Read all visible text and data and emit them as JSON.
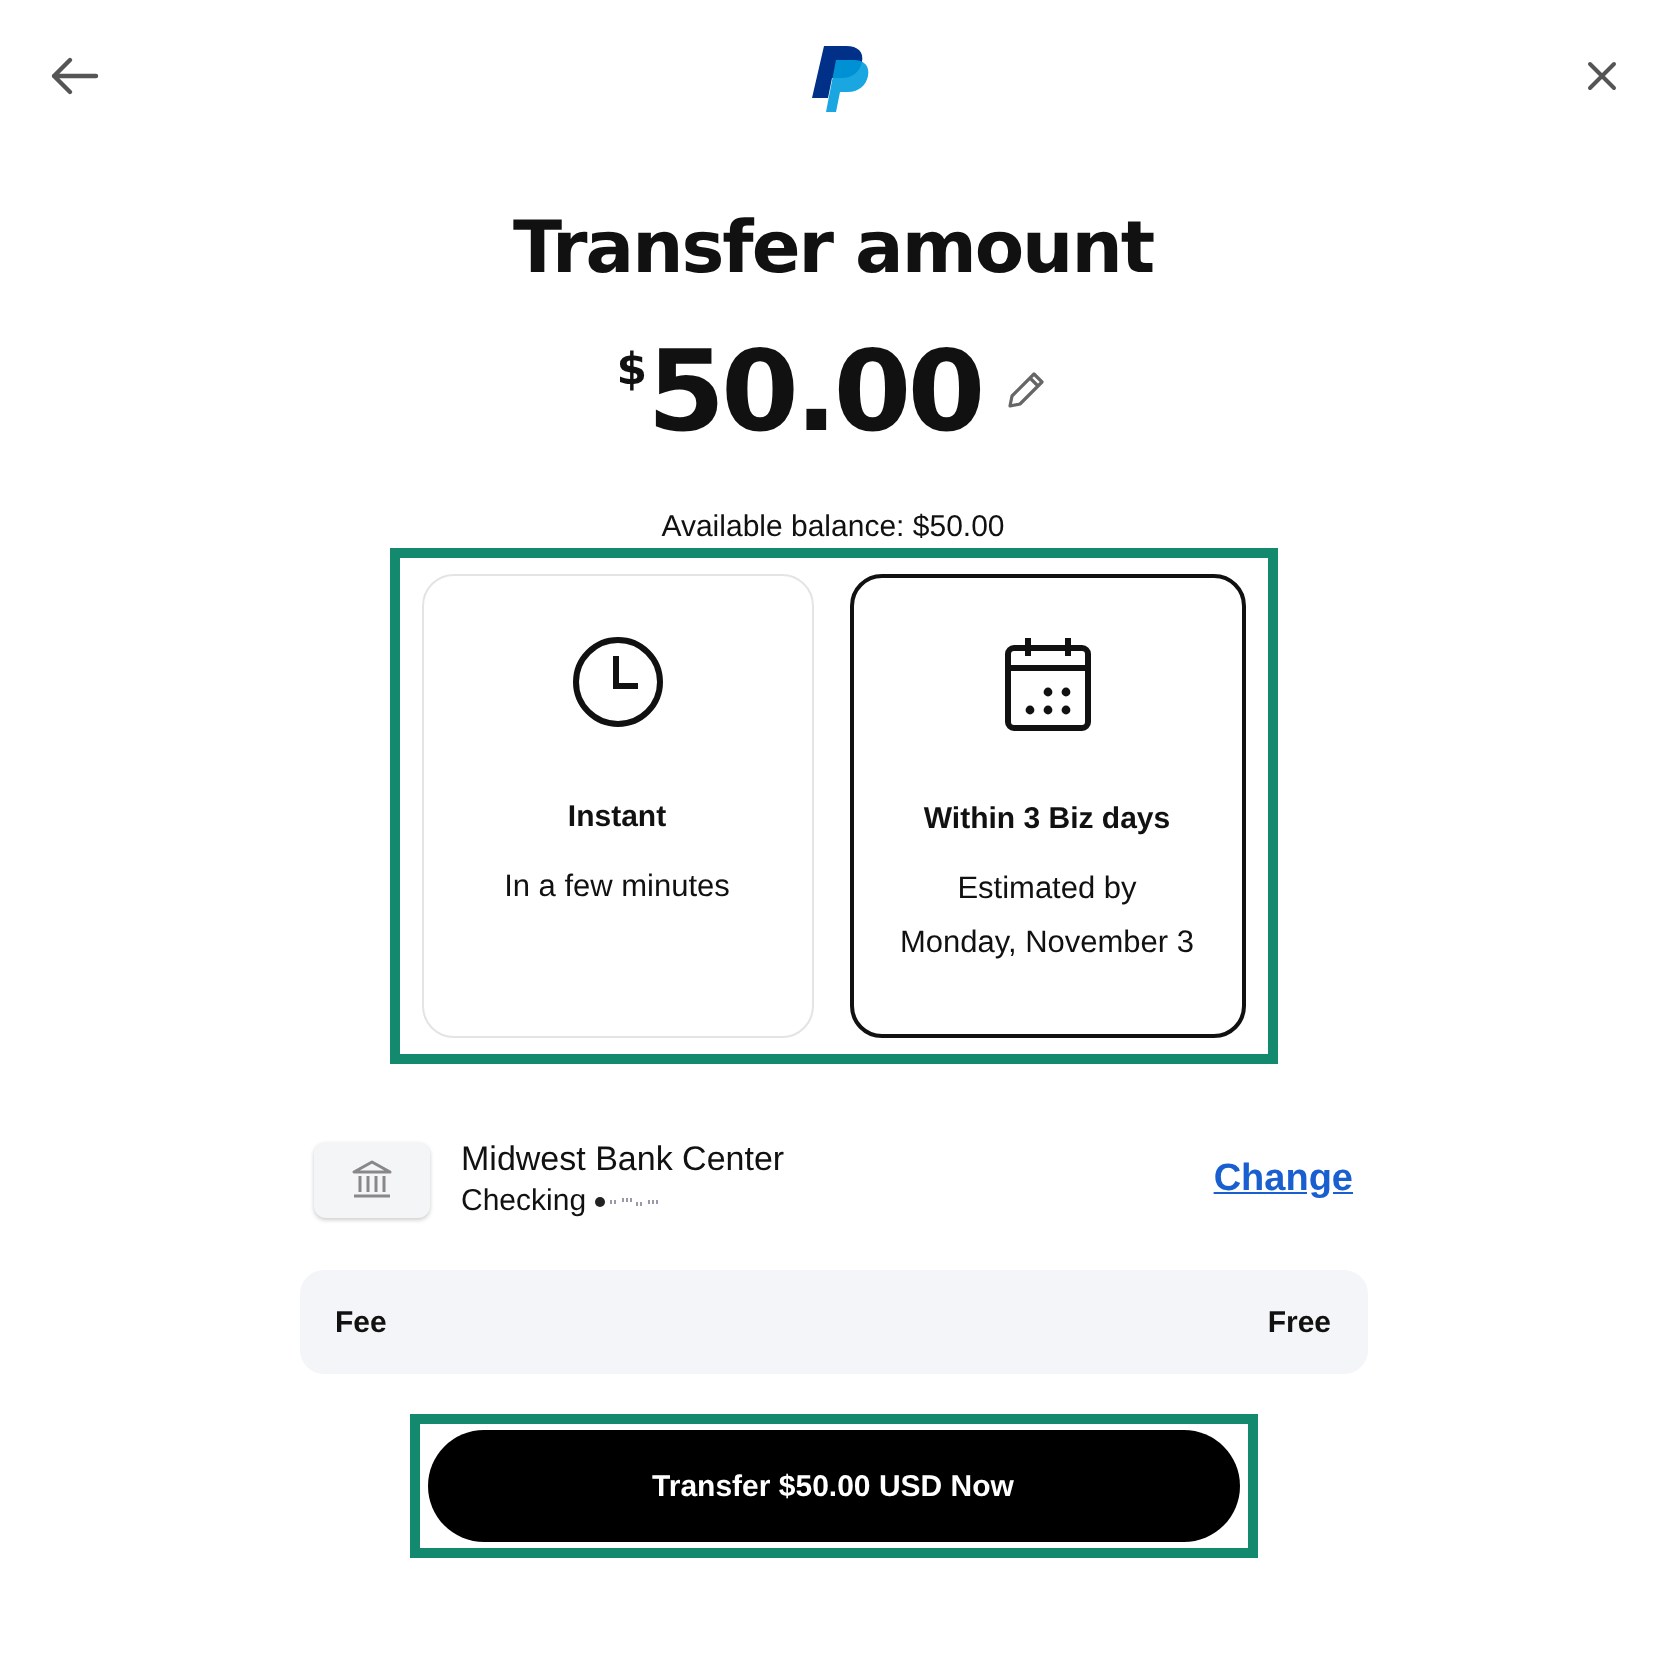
{
  "title": "Transfer amount",
  "amount": {
    "currency": "$",
    "value": "50.00"
  },
  "available_balance": "Available balance: $50.00",
  "options": [
    {
      "kind": "instant",
      "label": "Instant",
      "detail_lines": [
        "In a few minutes"
      ],
      "selected": false
    },
    {
      "kind": "scheduled",
      "label": "Within 3 Biz days",
      "detail_lines": [
        "Estimated by",
        "Monday, November 3"
      ],
      "selected": true
    }
  ],
  "bank": {
    "name": "Midwest Bank Center",
    "account": "Checking",
    "change_link": "Change"
  },
  "fee": {
    "label": "Fee",
    "value": "Free"
  },
  "submit_button": "Transfer $50.00 USD Now"
}
